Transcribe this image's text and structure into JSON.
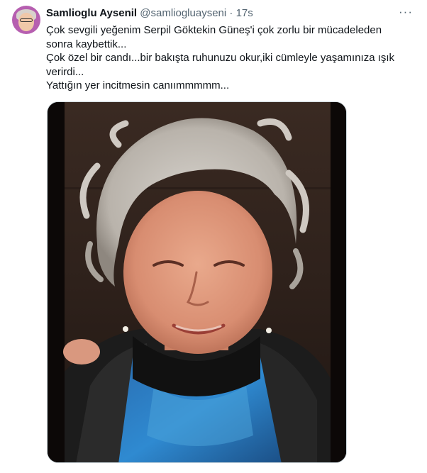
{
  "tweet": {
    "author_name": "Samlioglu Aysenil",
    "handle": "@samliogluayseni",
    "separator": "·",
    "time": "17s",
    "more_icon": "more-horizontal-icon",
    "lines": [
      "Çok sevgili yeğenim Serpil Göktekin Güneş'i çok zorlu bir mücadeleden",
      "sonra kaybettik...",
      "Çok özel bir candı...bir bakışta ruhunuzu okur,iki cümleyle yaşamınıza ışık",
      "verirdi...",
      "Yattığın yer incitmesin canıımmmmm..."
    ],
    "media_description": "photo"
  }
}
